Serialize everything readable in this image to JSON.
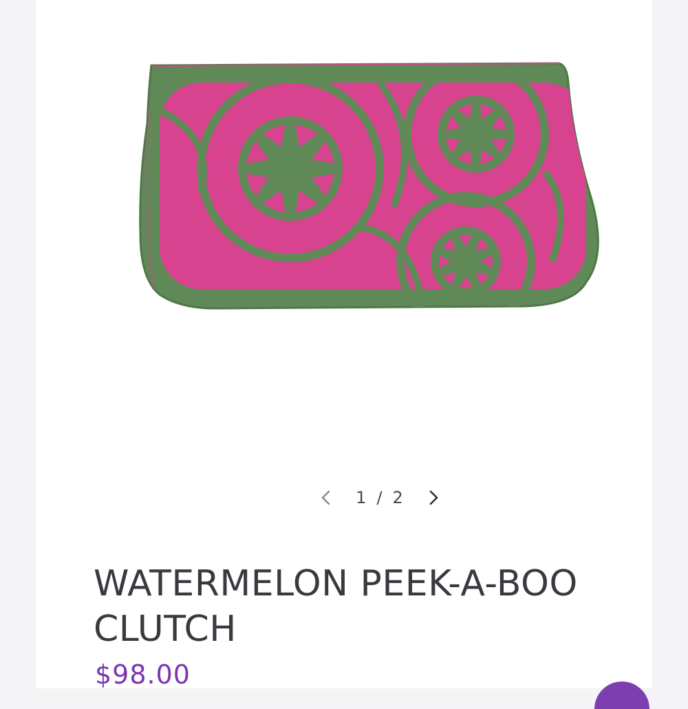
{
  "product": {
    "title": "WATERMELON PEEK-A-BOO CLUTCH",
    "price": "$98.00",
    "image_alt": "Green leather clutch with floral cut-out over pink suede"
  },
  "gallery": {
    "current": "1",
    "separator": "/",
    "total": "2",
    "prev_icon": "chevron-left-icon",
    "next_icon": "chevron-right-icon"
  },
  "colors": {
    "leather_green": "#5f8a57",
    "suede_pink": "#d8438f",
    "price_purple": "#7a35b0",
    "text_dark": "#3b3840"
  }
}
